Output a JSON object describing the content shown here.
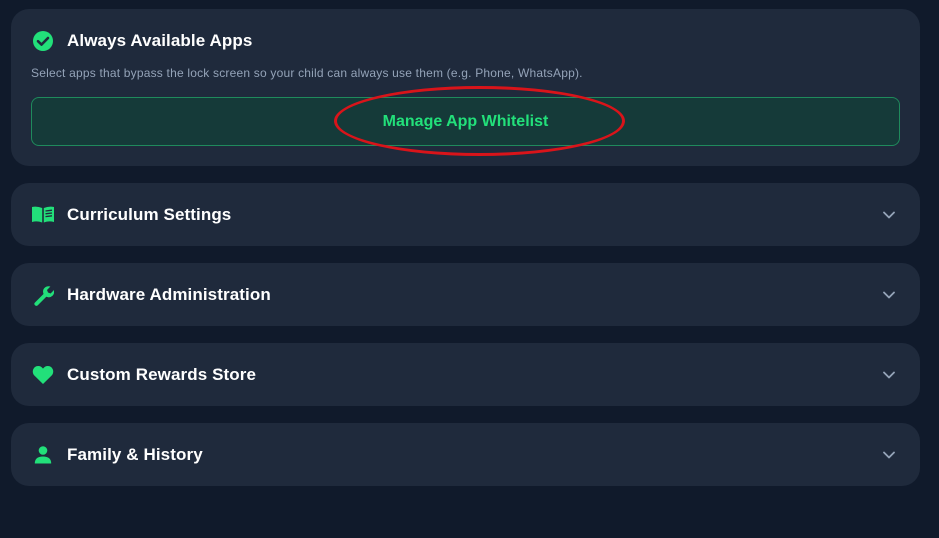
{
  "top_card": {
    "title": "Always Available Apps",
    "description": "Select apps that bypass the lock screen so your child can always use them (e.g. Phone, WhatsApp).",
    "button_label": "Manage App Whitelist",
    "icon": "check-circle-icon"
  },
  "sections": [
    {
      "title": "Curriculum Settings",
      "icon": "book-icon"
    },
    {
      "title": "Hardware Administration",
      "icon": "wrench-icon"
    },
    {
      "title": "Custom Rewards Store",
      "icon": "heart-icon"
    },
    {
      "title": "Family & History",
      "icon": "person-icon"
    }
  ],
  "colors": {
    "accent": "#22e07a",
    "card_bg": "#1f2a3c",
    "page_bg": "#101a2b",
    "highlight": "#d9141a"
  }
}
